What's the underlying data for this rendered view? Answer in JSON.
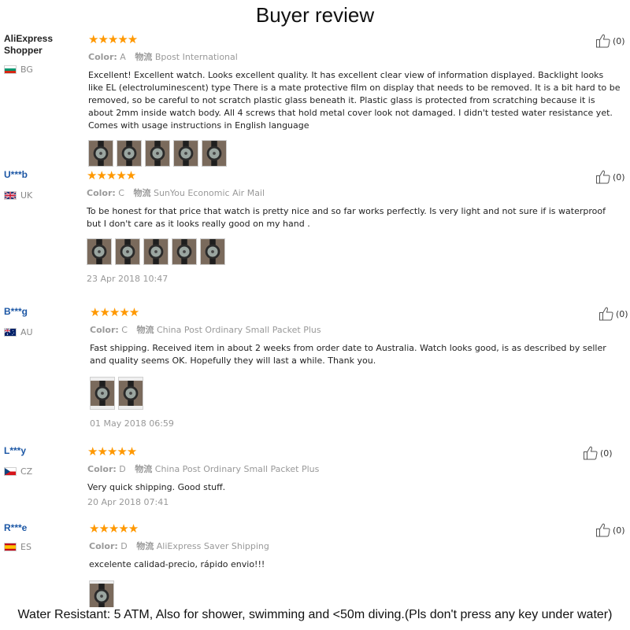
{
  "page": {
    "title": "Buyer review",
    "footer_note": "Water Resistant: 5 ATM, Also for shower, swimming and <50m diving.(Pls don't press any key under water)"
  },
  "colors": {
    "star": "#ff9800",
    "author_link": "#1c57a5",
    "muted_text": "#999999"
  },
  "reviews": [
    {
      "author": "AliExpress Shopper",
      "country_code": "BG",
      "flag_icon": "bulgaria-flag-icon",
      "rating": 5,
      "stars": "★★★★★",
      "color_label": "Color:",
      "color_value": "A",
      "logistics_label": "物流",
      "logistics_value": "Bpost International",
      "text": "Excellent! Excellent watch. Looks excellent quality. It has excellent clear view of information displayed. Backlight looks like EL (electroluminescent) type There is a mate protective film on display that needs to be removed. It is a bit hard to be removed, so be careful to not scratch plastic glass beneath it. Plastic glass is protected from scratching because it is about 2mm inside watch body. All 4 screws that hold metal cover look not damaged. I didn't tested water resistance yet. Comes with usage instructions in English language",
      "photo_count": 5,
      "date": "",
      "helpful_count": "(0)"
    },
    {
      "author": "U***b",
      "country_code": "UK",
      "flag_icon": "uk-flag-icon",
      "rating": 5,
      "stars": "★★★★★",
      "color_label": "Color:",
      "color_value": "C",
      "logistics_label": "物流",
      "logistics_value": "SunYou Economic Air Mail",
      "text": "To be honest for that price that watch is pretty nice and so far works perfectly. Is very light and not sure if is waterproof but I don't care as it looks really good on my hand .",
      "photo_count": 5,
      "date": "23 Apr 2018 10:47",
      "helpful_count": "(0)"
    },
    {
      "author": "B***g",
      "country_code": "AU",
      "flag_icon": "australia-flag-icon",
      "rating": 5,
      "stars": "★★★★★",
      "color_label": "Color:",
      "color_value": "C",
      "logistics_label": "物流",
      "logistics_value": "China Post Ordinary Small Packet Plus",
      "text": "Fast shipping. Received item in about 2 weeks from order date to Australia. Watch looks good, is as described by seller and quality seems OK. Hopefully they will last a while. Thank you.",
      "photo_count": 2,
      "date": "01 May 2018 06:59",
      "helpful_count": "(0)"
    },
    {
      "author": "L***y",
      "country_code": "CZ",
      "flag_icon": "czech-flag-icon",
      "rating": 5,
      "stars": "★★★★★",
      "color_label": "Color:",
      "color_value": "D",
      "logistics_label": "物流",
      "logistics_value": "China Post Ordinary Small Packet Plus",
      "text": "Very quick shipping. Good stuff.",
      "photo_count": 0,
      "date": "20 Apr 2018 07:41",
      "helpful_count": "(0)"
    },
    {
      "author": "R***e",
      "country_code": "ES",
      "flag_icon": "spain-flag-icon",
      "rating": 5,
      "stars": "★★★★★",
      "color_label": "Color:",
      "color_value": "D",
      "logistics_label": "物流",
      "logistics_value": "AliExpress Saver Shipping",
      "text": "excelente calidad-precio, rápido envio!!!",
      "photo_count": 1,
      "date": "",
      "helpful_count": "(0)"
    }
  ]
}
